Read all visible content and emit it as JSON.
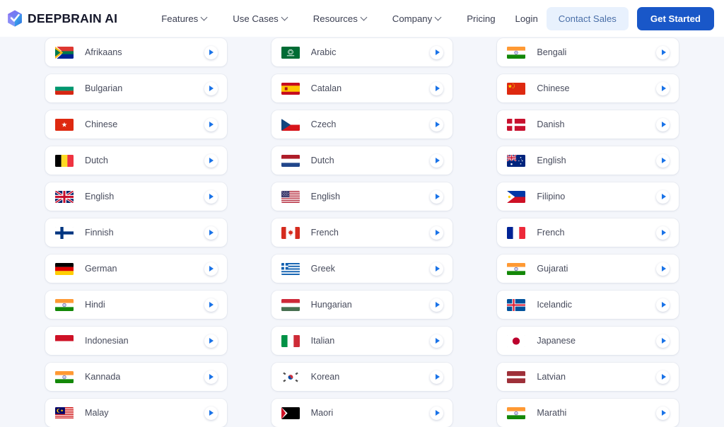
{
  "header": {
    "brand_name": "DEEPBRAIN",
    "brand_suffix": "AI",
    "logo_icon": "deepbrain-cube-logo",
    "nav": [
      {
        "label": "Features",
        "has_caret": true
      },
      {
        "label": "Use Cases",
        "has_caret": true
      },
      {
        "label": "Resources",
        "has_caret": true
      },
      {
        "label": "Company",
        "has_caret": true
      },
      {
        "label": "Pricing",
        "has_caret": false
      }
    ],
    "login_label": "Login",
    "contact_sales_label": "Contact Sales",
    "get_started_label": "Get Started",
    "accent_primary": "#1957c8",
    "accent_soft_bg": "#e8f1fd"
  },
  "language_grid": {
    "play_icon": "play-icon",
    "columns": [
      {
        "items": [
          {
            "label": "Afrikaans",
            "flag": "za"
          },
          {
            "label": "Bulgarian",
            "flag": "bg"
          },
          {
            "label": "Chinese",
            "flag": "hk"
          },
          {
            "label": "Dutch",
            "flag": "be"
          },
          {
            "label": "English",
            "flag": "gb"
          },
          {
            "label": "Finnish",
            "flag": "fi"
          },
          {
            "label": "German",
            "flag": "de"
          },
          {
            "label": "Hindi",
            "flag": "in"
          },
          {
            "label": "Indonesian",
            "flag": "id"
          },
          {
            "label": "Kannada",
            "flag": "in"
          },
          {
            "label": "Malay",
            "flag": "my"
          }
        ]
      },
      {
        "items": [
          {
            "label": "Arabic",
            "flag": "sa"
          },
          {
            "label": "Catalan",
            "flag": "es"
          },
          {
            "label": "Czech",
            "flag": "cz"
          },
          {
            "label": "Dutch",
            "flag": "nl"
          },
          {
            "label": "English",
            "flag": "us"
          },
          {
            "label": "French",
            "flag": "ca"
          },
          {
            "label": "Greek",
            "flag": "gr"
          },
          {
            "label": "Hungarian",
            "flag": "hu"
          },
          {
            "label": "Italian",
            "flag": "it"
          },
          {
            "label": "Korean",
            "flag": "kr"
          },
          {
            "label": "Maori",
            "flag": "nz"
          }
        ]
      },
      {
        "items": [
          {
            "label": "Bengali",
            "flag": "in"
          },
          {
            "label": "Chinese",
            "flag": "cn"
          },
          {
            "label": "Danish",
            "flag": "dk"
          },
          {
            "label": "English",
            "flag": "au"
          },
          {
            "label": "Filipino",
            "flag": "ph"
          },
          {
            "label": "French",
            "flag": "fr"
          },
          {
            "label": "Gujarati",
            "flag": "in"
          },
          {
            "label": "Icelandic",
            "flag": "is"
          },
          {
            "label": "Japanese",
            "flag": "jp"
          },
          {
            "label": "Latvian",
            "flag": "lv"
          },
          {
            "label": "Marathi",
            "flag": "in"
          }
        ]
      }
    ]
  }
}
